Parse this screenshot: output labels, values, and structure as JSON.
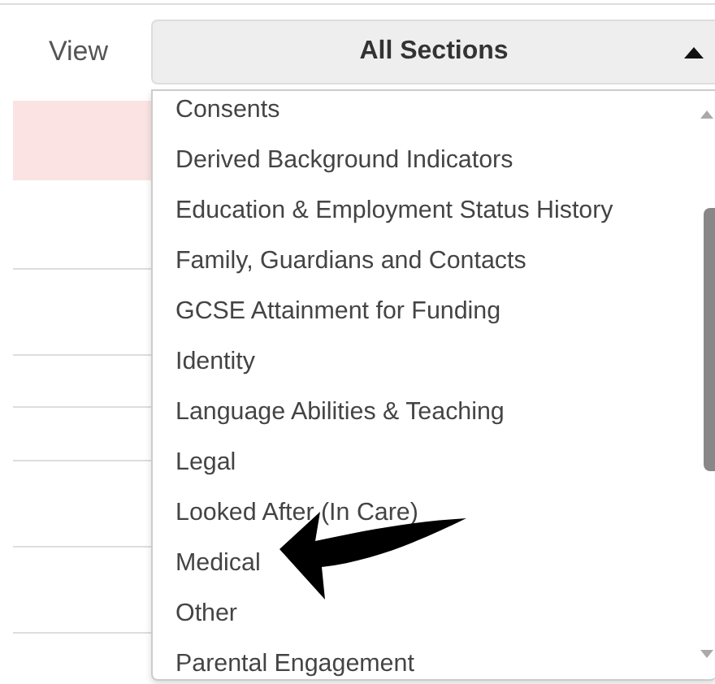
{
  "view_filter": {
    "label": "View",
    "value": "All Sections",
    "expanded": true,
    "options": [
      {
        "label": "Consents"
      },
      {
        "label": "Derived Background Indicators"
      },
      {
        "label": "Education & Employment Status History"
      },
      {
        "label": "Family, Guardians and Contacts"
      },
      {
        "label": "GCSE Attainment for Funding"
      },
      {
        "label": "Identity"
      },
      {
        "label": "Language Abilities & Teaching"
      },
      {
        "label": "Legal"
      },
      {
        "label": "Looked After (In Care)"
      },
      {
        "label": "Medical"
      },
      {
        "label": "Other"
      },
      {
        "label": "Parental Engagement"
      }
    ]
  }
}
